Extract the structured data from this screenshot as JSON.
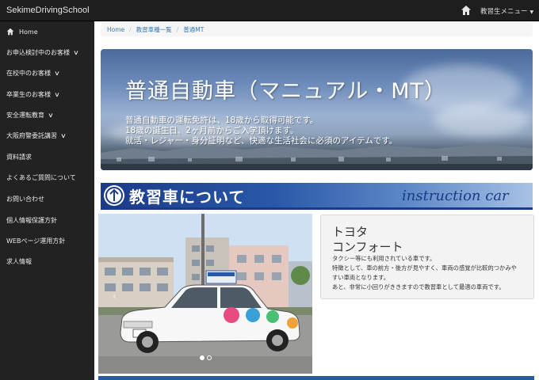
{
  "app": {
    "brand": "SekimeDrivingSchool"
  },
  "topnav": {
    "menu_label": "教習生メニュー",
    "caret": "▼"
  },
  "sidebar": {
    "items": [
      {
        "label": "Home",
        "has_icon": true
      },
      {
        "label": "お申込検討中のお客様",
        "chevron": "∨"
      },
      {
        "label": "在校中のお客様",
        "chevron": "∨"
      },
      {
        "label": "卒業生のお客様",
        "chevron": "∨"
      },
      {
        "label": "安全運転教育",
        "chevron": "∨"
      },
      {
        "label": "大阪府警委託講習",
        "chevron": "∨"
      },
      {
        "label": "資料請求"
      },
      {
        "label": "よくあるご質問について"
      },
      {
        "label": "お問い合わせ"
      },
      {
        "label": "個人情報保護方針"
      },
      {
        "label": "WEBページ運用方針"
      },
      {
        "label": "求人情報"
      }
    ]
  },
  "breadcrumb": {
    "items": [
      "Home",
      "教習車種一覧",
      "普通MT"
    ],
    "separator": "/"
  },
  "hero": {
    "title": "普通自動車（マニュアル・MT）",
    "lines": [
      "普通自動車の運転免許は、18歳から取得可能です。",
      "18歳の誕生日、2ヶ月前からご入学頂けます。",
      "就活・レジャー・身分証明など、快適な生活社会に必須のアイテムです。"
    ]
  },
  "section_banner": {
    "title": "教習車について",
    "subtitle": "instruction car"
  },
  "carousel": {
    "prev_arrow": "‹",
    "slides": 2,
    "active": 0
  },
  "car_card": {
    "maker": "トヨタ",
    "model": "コンフォート",
    "lines": [
      "タクシー等にも利用されている車です。",
      "特徴として、車の前方・後方が見やすく、車両の感覚が比較的つかみや",
      "すい車両となります。",
      "あと、非常に小回りがききますので教習車として最適の車両です。"
    ]
  },
  "colors": {
    "topbar": "#1e1e1e",
    "sidebar": "#222222",
    "link": "#337ab7",
    "banner_blue": "#1b3a87"
  }
}
